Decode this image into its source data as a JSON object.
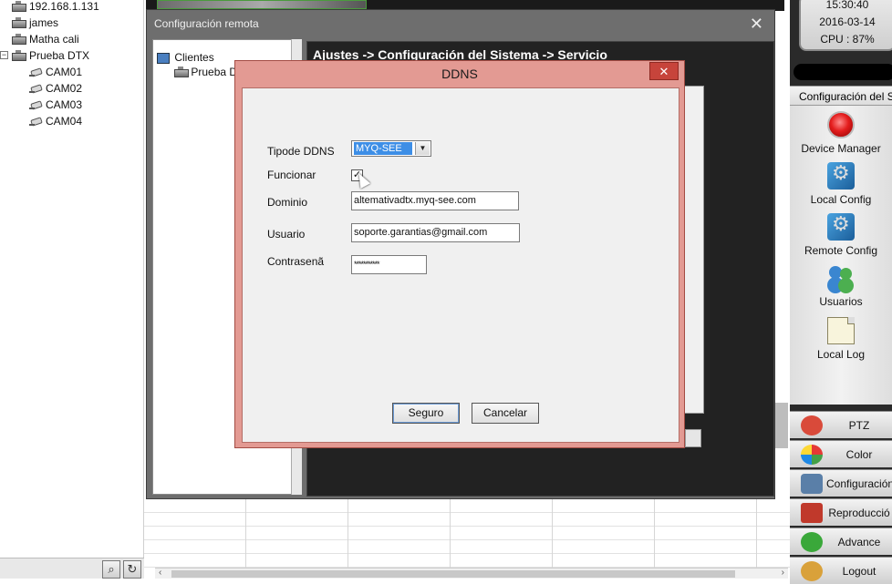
{
  "left_tree": {
    "items": [
      {
        "label": "192.168.1.131",
        "kind": "device"
      },
      {
        "label": "james",
        "kind": "device"
      },
      {
        "label": "Matha cali",
        "kind": "device"
      },
      {
        "label": "Prueba DTX",
        "kind": "device"
      },
      {
        "label": "CAM01",
        "kind": "camera"
      },
      {
        "label": "CAM02",
        "kind": "camera"
      },
      {
        "label": "CAM03",
        "kind": "camera"
      },
      {
        "label": "CAM04",
        "kind": "camera"
      }
    ],
    "expander": "−",
    "bottom_icons": [
      "search-icon",
      "refresh-icon"
    ]
  },
  "status": {
    "time": "15:30:40",
    "date": "2016-03-14",
    "cpu": "CPU : 87%"
  },
  "right_menu": {
    "title": "Configuración del S",
    "items": [
      {
        "label": "Device Manager",
        "icon": "device-manager-icon"
      },
      {
        "label": "Local Config",
        "icon": "local-config-icon"
      },
      {
        "label": "Remote Config",
        "icon": "remote-config-icon"
      },
      {
        "label": "Usuarios",
        "icon": "users-icon"
      },
      {
        "label": "Local Log",
        "icon": "local-log-icon"
      }
    ],
    "buttons": [
      {
        "label": "PTZ",
        "icon": "ptz-icon",
        "color": "#d94a3a"
      },
      {
        "label": "Color",
        "icon": "color-icon",
        "color": "#3a7fd9"
      },
      {
        "label": "Configuración del S",
        "icon": "system-config-icon",
        "color": "#5a7fa8"
      },
      {
        "label": "Reproducció",
        "icon": "playback-icon",
        "color": "#c0392b"
      },
      {
        "label": "Advance",
        "icon": "advance-icon",
        "color": "#3aa83a"
      },
      {
        "label": "Logout",
        "icon": "logout-icon",
        "color": "#d9a13a"
      }
    ]
  },
  "remote_window": {
    "title": "Configuración remota",
    "close_glyph": "✕",
    "tree": {
      "root": "Clientes",
      "child": "Prueba DT"
    },
    "breadcrumb": "Ajustes -> Configuración del Sistema -> Servicio"
  },
  "ddns_dialog": {
    "title": "DDNS",
    "close_glyph": "✕",
    "fields": {
      "tipo_label": "Tipode DDNS",
      "tipo_value": "MYQ-SEE",
      "funcionar_label": "Funcionar",
      "funcionar_checked": true,
      "dominio_label": "Dominio",
      "dominio_value": "altemativadtx.myq-see.com",
      "usuario_label": "Usuario",
      "usuario_value": "soporte.garantias@gmail.com",
      "contrasena_label": "Contrasenã",
      "contrasena_value": "***********"
    },
    "ok_label": "Seguro",
    "cancel_label": "Cancelar"
  },
  "colors": {
    "dialog_frame": "#e39a93",
    "dialog_close": "#c7443b",
    "selection": "#3d8ee6",
    "dark_panel": "#222222"
  }
}
